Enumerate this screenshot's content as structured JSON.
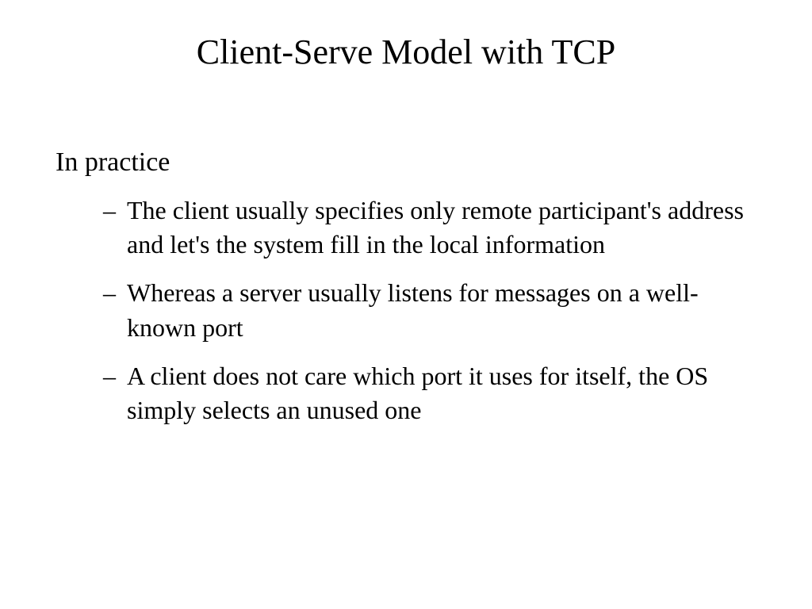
{
  "slide": {
    "title": "Client-Serve Model with TCP",
    "intro": "In practice",
    "bullets": [
      "The client usually specifies only remote participant's address and let's the system fill in the local information",
      "Whereas a server usually listens for messages on a well-known port",
      "A client does not care which port it uses for itself, the OS simply selects an unused one"
    ]
  }
}
